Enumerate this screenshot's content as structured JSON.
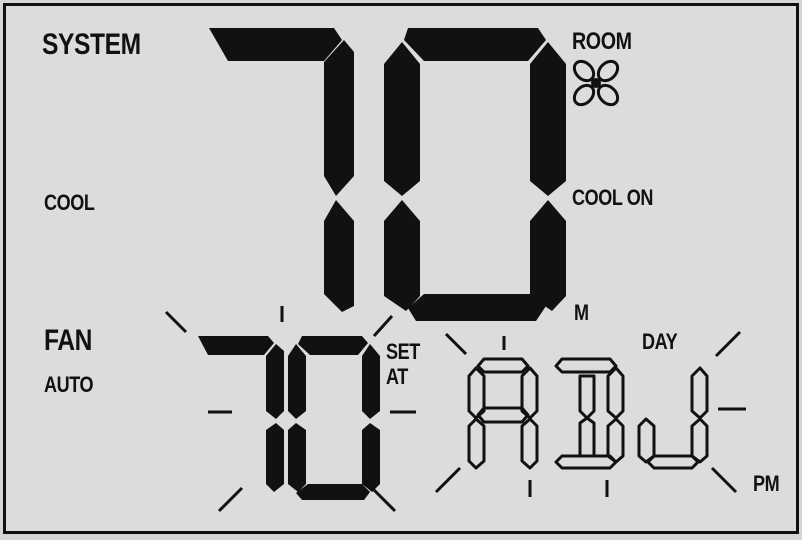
{
  "labels": {
    "system": "SYSTEM",
    "room": "ROOM",
    "cool": "COOL",
    "cool_on": "COOL ON",
    "m": "M",
    "fan": "FAN",
    "auto": "AUTO",
    "set": "SET",
    "at": "AT",
    "day": "DAY",
    "pm": "PM"
  },
  "display": {
    "room_temperature": "70",
    "set_temperature": "70",
    "message": "ADJ"
  },
  "icons": {
    "fan": "fan-icon",
    "flash": "flash-rays-icon"
  },
  "colors": {
    "background": "#dcdcdc",
    "segment": "#111111"
  }
}
